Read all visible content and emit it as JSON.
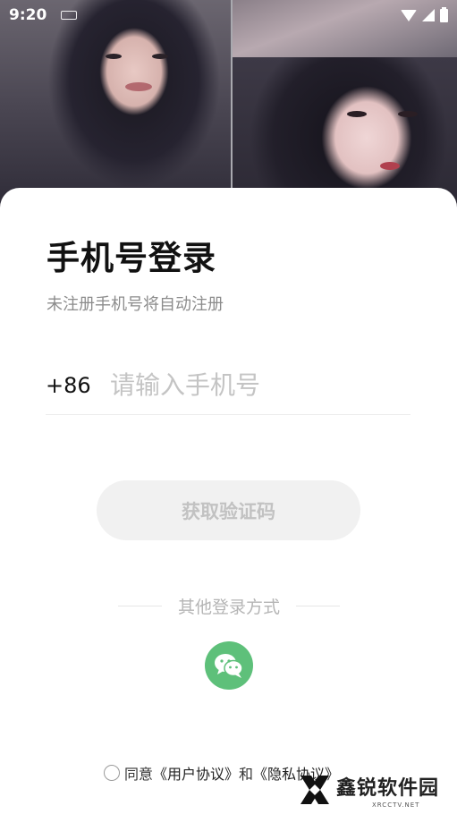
{
  "status_bar": {
    "time": "9:20"
  },
  "login": {
    "title": "手机号登录",
    "subtitle": "未注册手机号将自动注册",
    "country_code": "+86",
    "phone_placeholder": "请输入手机号",
    "get_code_label": "获取验证码",
    "other_login_label": "其他登录方式",
    "agreement": {
      "prefix": "同意",
      "user_agreement": "《用户协议》",
      "and": "和",
      "privacy_policy": "《隐私协议》"
    }
  },
  "watermark": {
    "name": "鑫锐软件园",
    "domain": "XRCCTV.NET"
  },
  "colors": {
    "wechat_green": "#5ec07a",
    "button_disabled_bg": "#f1f1f1",
    "placeholder": "#c4c4c4"
  },
  "icons": [
    "keyboard-icon",
    "wifi-icon",
    "signal-icon",
    "battery-icon",
    "wechat-icon",
    "checkbox-icon",
    "watermark-logo-icon"
  ]
}
